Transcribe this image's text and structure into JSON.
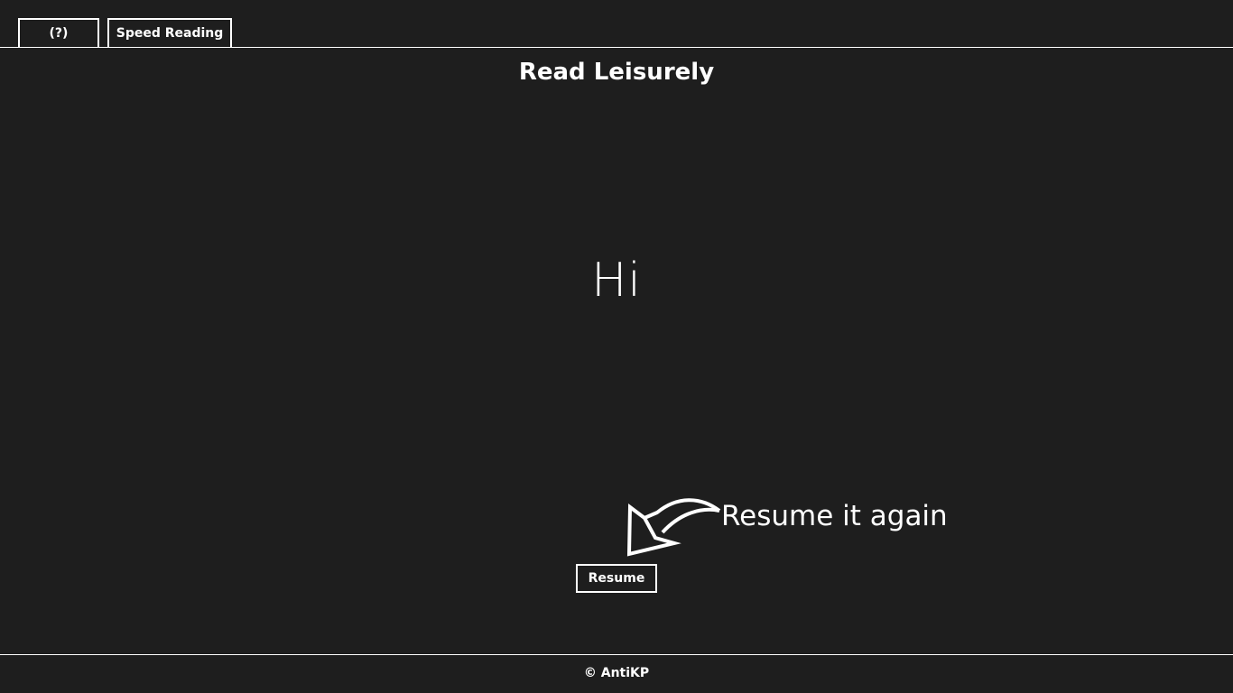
{
  "colors": {
    "background": "#1e1e1e",
    "foreground": "#ffffff"
  },
  "toolbar": {
    "help_label": "(?)",
    "speed_reading_label": "Speed Reading"
  },
  "page": {
    "title": "Read Leisurely"
  },
  "reader": {
    "current_word": "Hi"
  },
  "hint": {
    "text": "Resume it again",
    "icon": "curved-arrow-icon"
  },
  "controls": {
    "resume_label": "Resume"
  },
  "footer": {
    "copyright": "© AntiKP"
  }
}
